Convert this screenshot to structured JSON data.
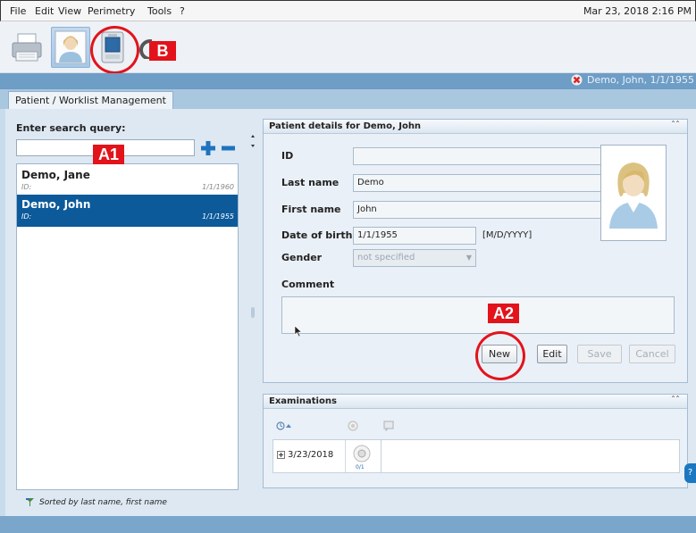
{
  "menubar": {
    "items": [
      "File",
      "Edit",
      "View",
      "Perimetry",
      "Tools",
      "?"
    ],
    "datetime": "Mar 23, 2018 2:16 PM"
  },
  "toolbar": {
    "buttons": [
      "printer-icon",
      "patient-icon",
      "device-icon"
    ]
  },
  "annotations": {
    "b": "B",
    "a1": "A1",
    "a2": "A2",
    "color": "#e3131b"
  },
  "active_patient": "Demo, John, 1/1/1955",
  "tabs": [
    "Patient / Worklist Management"
  ],
  "left": {
    "search_label": "Enter search query:",
    "search_value": "",
    "patients": [
      {
        "name": "Demo, Jane",
        "id_label": "ID:",
        "dob": "1/1/1960",
        "selected": false
      },
      {
        "name": "Demo, John",
        "id_label": "ID:",
        "dob": "1/1/1955",
        "selected": true
      }
    ],
    "sort_note": "Sorted by last name, first name"
  },
  "details": {
    "title": "Patient details for Demo, John",
    "fields": {
      "id_label": "ID",
      "id_value": "",
      "last_label": "Last name",
      "last_value": "Demo",
      "first_label": "First name",
      "first_value": "John",
      "dob_label": "Date of birth",
      "dob_value": "1/1/1955",
      "dob_hint": "[M/D/YYYY]",
      "gender_label": "Gender",
      "gender_value": "not specified"
    },
    "comment_label": "Comment",
    "comment_value": "",
    "buttons": {
      "new": "New",
      "edit": "Edit",
      "save": "Save",
      "cancel": "Cancel"
    }
  },
  "examinations": {
    "title": "Examinations",
    "rows": [
      {
        "date": "3/23/2018",
        "count": "0/1"
      }
    ]
  },
  "colors": {
    "selected_row": "#0c5a9a",
    "accent_strip": "#6e9dc6"
  }
}
